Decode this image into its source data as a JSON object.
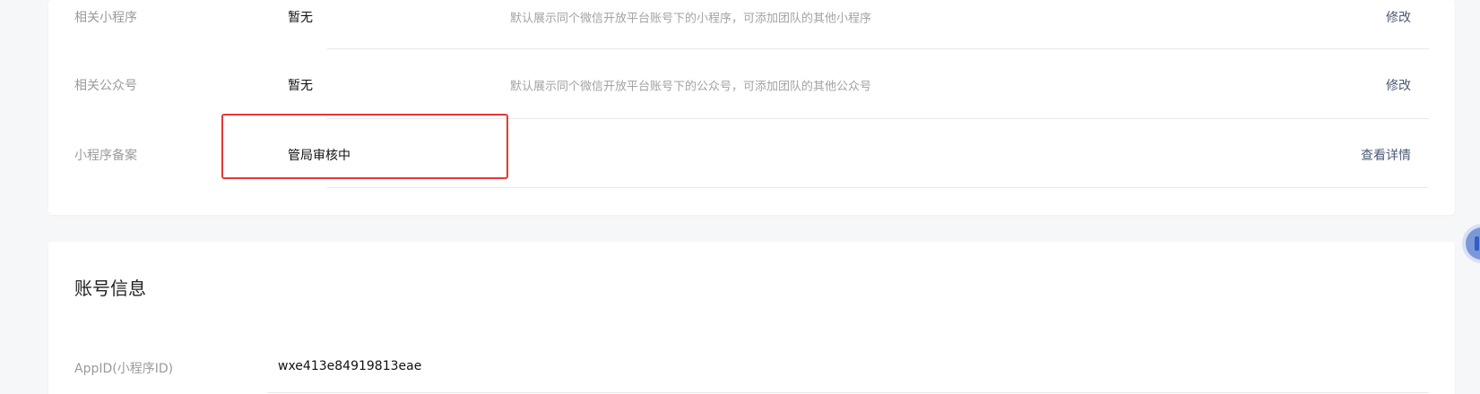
{
  "top_card": {
    "rows": [
      {
        "label": "相关小程序",
        "value": "暂无",
        "description": "默认展示同个微信开放平台账号下的小程序，可添加团队的其他小程序",
        "action": "修改"
      },
      {
        "label": "相关公众号",
        "value": "暂无",
        "description": "默认展示同个微信开放平台账号下的公众号，可添加团队的其他公众号",
        "action": "修改"
      },
      {
        "label": "小程序备案",
        "value": "管局审核中",
        "description": "",
        "action": "查看详情"
      }
    ]
  },
  "account_info": {
    "title": "账号信息",
    "appid_label": "AppID(小程序ID)",
    "appid_value": "wxe413e84919813eae"
  },
  "colors": {
    "highlight": "#e53935",
    "link": "#4c5a75"
  },
  "icons": {
    "floating_button": "sidebar-toggle-icon"
  }
}
